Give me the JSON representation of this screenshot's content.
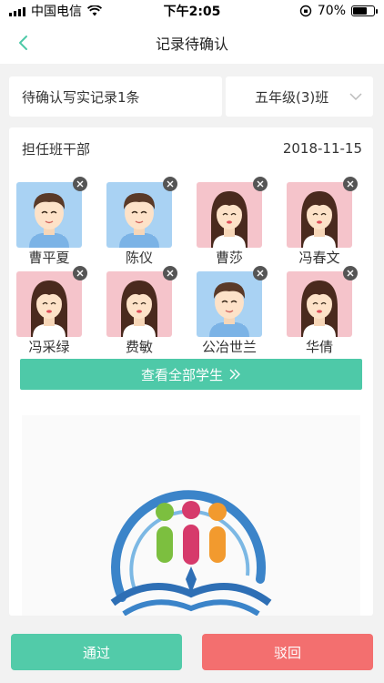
{
  "status": {
    "carrier": "中国电信",
    "time": "下午2:05",
    "battery": "70%",
    "battery_level": 0.7
  },
  "nav": {
    "title": "记录待确认",
    "back_icon": "chevron-left-icon",
    "accent": "#4ec9a8"
  },
  "filter": {
    "pending": "待确认写实记录1条",
    "class_select": "五年级(3)班"
  },
  "card": {
    "role": "担任班干部",
    "date": "2018-11-15"
  },
  "students": [
    {
      "name": "曹平夏",
      "gender": "male"
    },
    {
      "name": "陈仪",
      "gender": "male"
    },
    {
      "name": "曹莎",
      "gender": "female"
    },
    {
      "name": "冯春文",
      "gender": "female"
    },
    {
      "name": "冯采绿",
      "gender": "female"
    },
    {
      "name": "费敏",
      "gender": "female"
    },
    {
      "name": "公冶世兰",
      "gender": "male"
    },
    {
      "name": "华倩",
      "gender": "female"
    }
  ],
  "view_all": {
    "label": "查看全部学生",
    "icon": "double-chevron-right-icon"
  },
  "actions": {
    "pass": "通过",
    "reject": "驳回",
    "pass_color": "#52cba9",
    "reject_color": "#f36f6f"
  }
}
